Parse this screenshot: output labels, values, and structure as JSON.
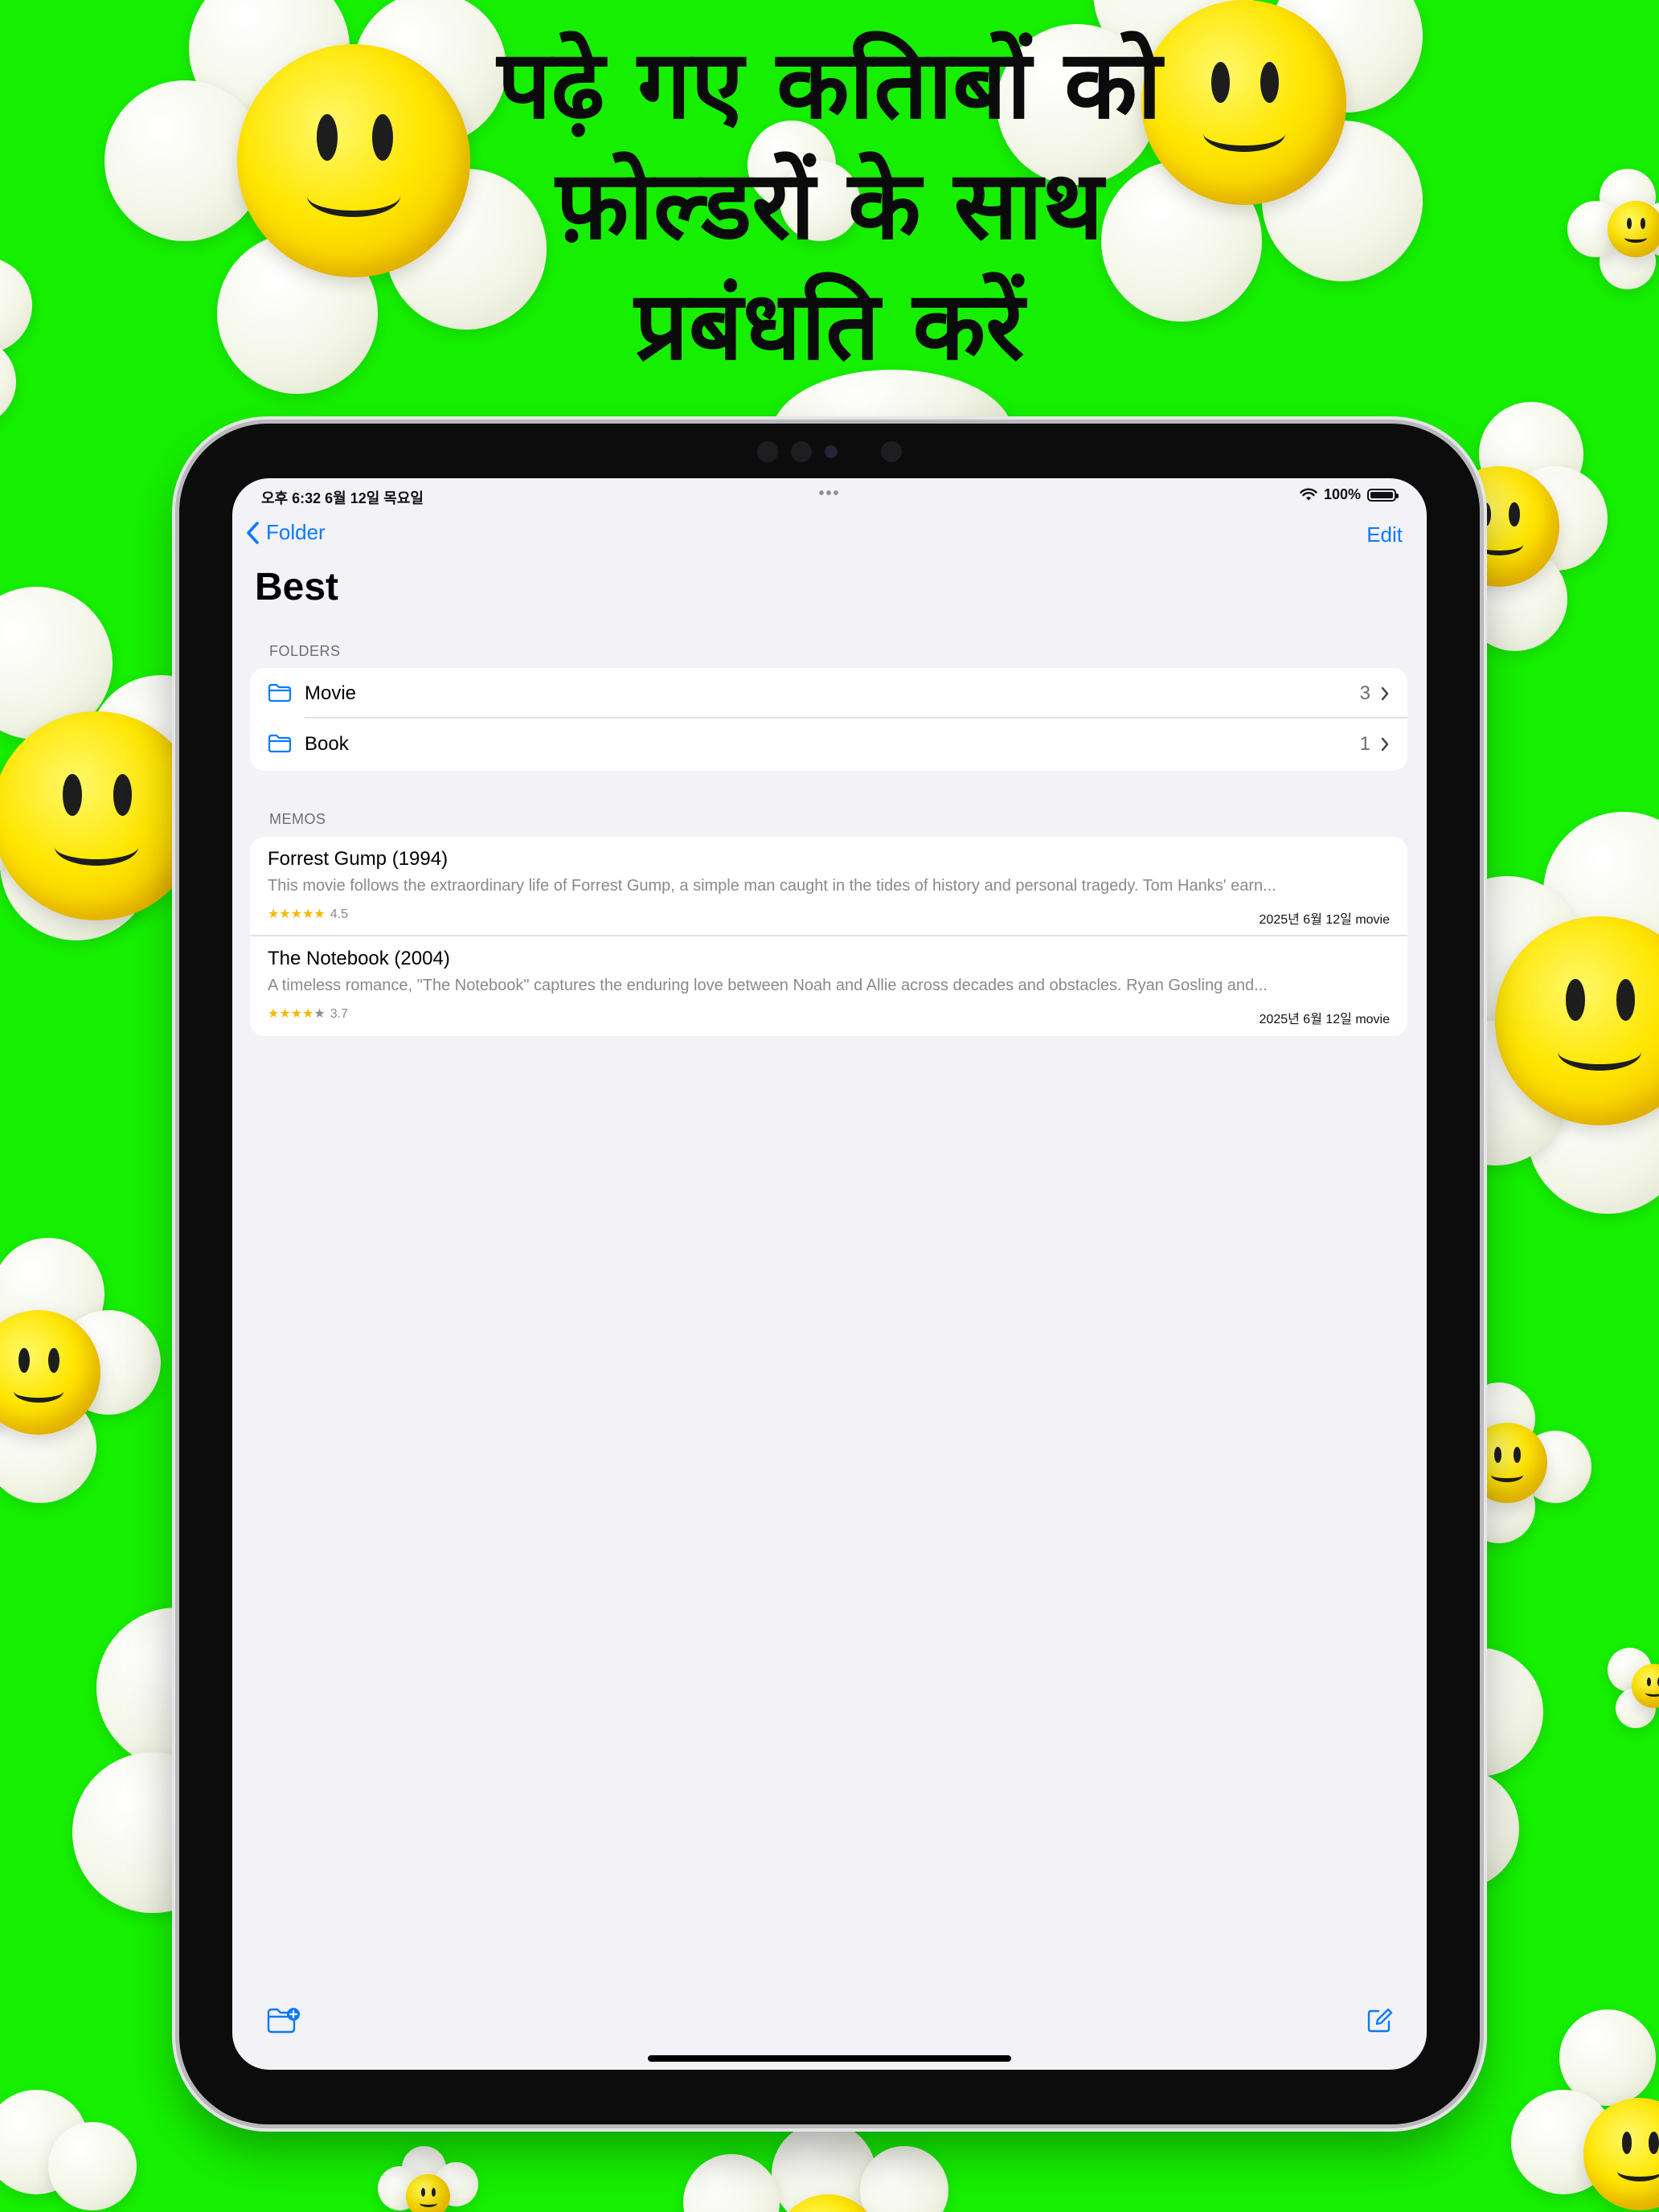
{
  "headline": {
    "line1": "पढ़े गए कतिाबों को",
    "line2": "फ़ोल्डरों के साथ",
    "line3": "प्रबंधति करें"
  },
  "status_bar": {
    "time_date": "오후 6:32   6월 12일 목요일",
    "dots": "•••",
    "battery": "100%"
  },
  "nav": {
    "back_label": "Folder",
    "edit_label": "Edit",
    "title": "Best"
  },
  "folders": {
    "header": "FOLDERS",
    "items": [
      {
        "name": "Movie",
        "count": "3"
      },
      {
        "name": "Book",
        "count": "1"
      }
    ]
  },
  "memos": {
    "header": "MEMOS",
    "items": [
      {
        "title": "Forrest Gump (1994)",
        "preview": "This movie follows the extraordinary life of Forrest Gump, a simple man caught in the tides of history and personal tragedy. Tom Hanks' earn...",
        "rating": 4.5,
        "rating_label": "4.5",
        "meta": "2025년 6월 12일 movie"
      },
      {
        "title": "The Notebook (2004)",
        "preview": "A timeless romance, \"The Notebook\" captures the enduring love between Noah and Allie across decades and obstacles. Ryan Gosling and...",
        "rating": 3.7,
        "rating_label": "3.7",
        "meta": "2025년 6월 12일 movie"
      }
    ]
  },
  "toolbar": {
    "new_folder_icon": "folder-badge-plus-icon",
    "compose_icon": "square-and-pencil-icon"
  },
  "colors": {
    "background": "#16f000",
    "accent": "#0a7aff",
    "star": "#f5b800",
    "screen": "#f2f2f7"
  }
}
